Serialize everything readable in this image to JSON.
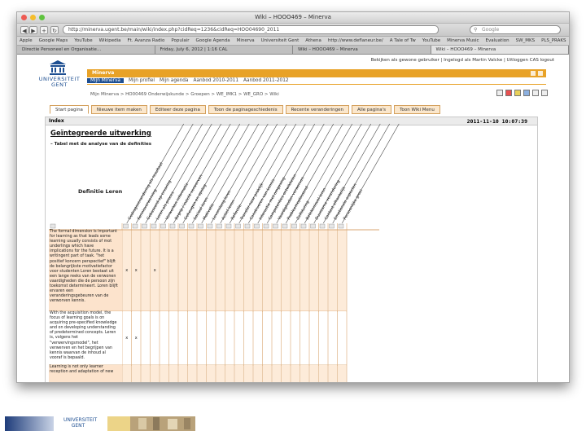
{
  "window": {
    "title": "Wiki – HOOO469 – Minerva",
    "address": "http://minerva.ugent.be/main/wiki/index.php?cidReq=1236&cidReq=HOO04690_2011",
    "search_placeholder": "Google",
    "bookmarks": [
      "Apple",
      "Google Maps",
      "YouTube",
      "Wikipedia",
      "Ft. Avanza Radio",
      "Populair",
      "Google Agenda",
      "Minerva",
      "Universiteit Gent",
      "Athena",
      "http://www.deflaneur.be/",
      "A Tale of Tw",
      "YouTube",
      "Minerva Music",
      "Evaluation",
      "SW_MKS",
      "PLS_PRAKS"
    ],
    "tabs": [
      "Directie Personeel en Organisatie...",
      "Friday, July 6, 2012 | 1:16 CAL",
      " Wiki – HOOO469 – Minerva",
      "Wiki – HOOO469 – Minerva"
    ]
  },
  "header": {
    "logo_text": "UNIVERSITEIT GENT",
    "top_links": "Bekijken als gewone gebruiker | Ingelogd als Martin Valcke | Uitloggen CAS logout",
    "app_name": "Minerva",
    "nav": [
      "Mijn Minerva",
      "Mijn profiel",
      "Mijn agenda",
      "Aanbod 2010-2011",
      "Aanbod 2011-2012"
    ]
  },
  "breadcrumb": "Mijn Minerva > HO00469 Onderwijskunde > Groepen > WE_IMK1 > WE_GRO > Wiki",
  "wiki_tabs": [
    "Start pagina",
    "Nieuwe item maken",
    "Editeer deze pagina",
    "Toon de paginageschiedenis",
    "Recente veranderingen",
    "Alle pagina's",
    "Toon Wiki Menu"
  ],
  "panel": {
    "header": "Index",
    "date": "2011-11-10 10:07:39",
    "title": "Geïntegreerde uitwerking",
    "subtitle": "– Tabel met de analyse van de definities",
    "definition_label": "Definitie Leren"
  },
  "columns": [
    "Gedragsverandering als resultaat",
    "Kennisverwerving",
    "Gebaseerd op ervaring",
    "Leren als proces",
    "Verwerken informatie",
    "Begrip / inzicht verwerven",
    "Geheugen en opslag",
    "Sociaal leren",
    "Motivatie",
    "Levenslang leren",
    "Actief leren",
    "Reflectie",
    "Transfer naar praktijk",
    "Construeren van kennis",
    "Interactie met omgeving",
    "Competenties ontwikkelen",
    "Vaardigheden verwerven",
    "Probleemoplossend",
    "Zelfsturing",
    "Betekenisvol leren",
    "Duurzame verandering",
    "Context afhankelijk",
    "Emotionele aspecten",
    "Persoonlijke groei"
  ],
  "rows": [
    {
      "text": "The formal dimension is important for learning as that leads some learning usually consists of mot underlings which have implications for the future. It is a writingent part of taak. \"het positief koncern perspectief\" blijft de belangrijkste motivatiefactor voor studenten Loren bestaat uit een lange reeks van de verwonen vaardigheden die de persoon zijn toekomst determineert. Loren blijft ervaren een veranderingsgebeuren van de verworven kennis.",
      "marks": [
        1,
        2,
        4
      ]
    },
    {
      "text": "With the acquisition model, the focus of learning goals is on acquiring pre-specified knowledge and on developing understanding of predetermined concepts. Leren is, volgens het \"verwervingsmodel\", het verwerven en het begrijpen van kennis waarvan de inhoud al vooraf is bepaald.",
      "marks": [
        1,
        2
      ]
    },
    {
      "text": "Learning is not only learner reception and adaptation of new",
      "marks": []
    }
  ]
}
